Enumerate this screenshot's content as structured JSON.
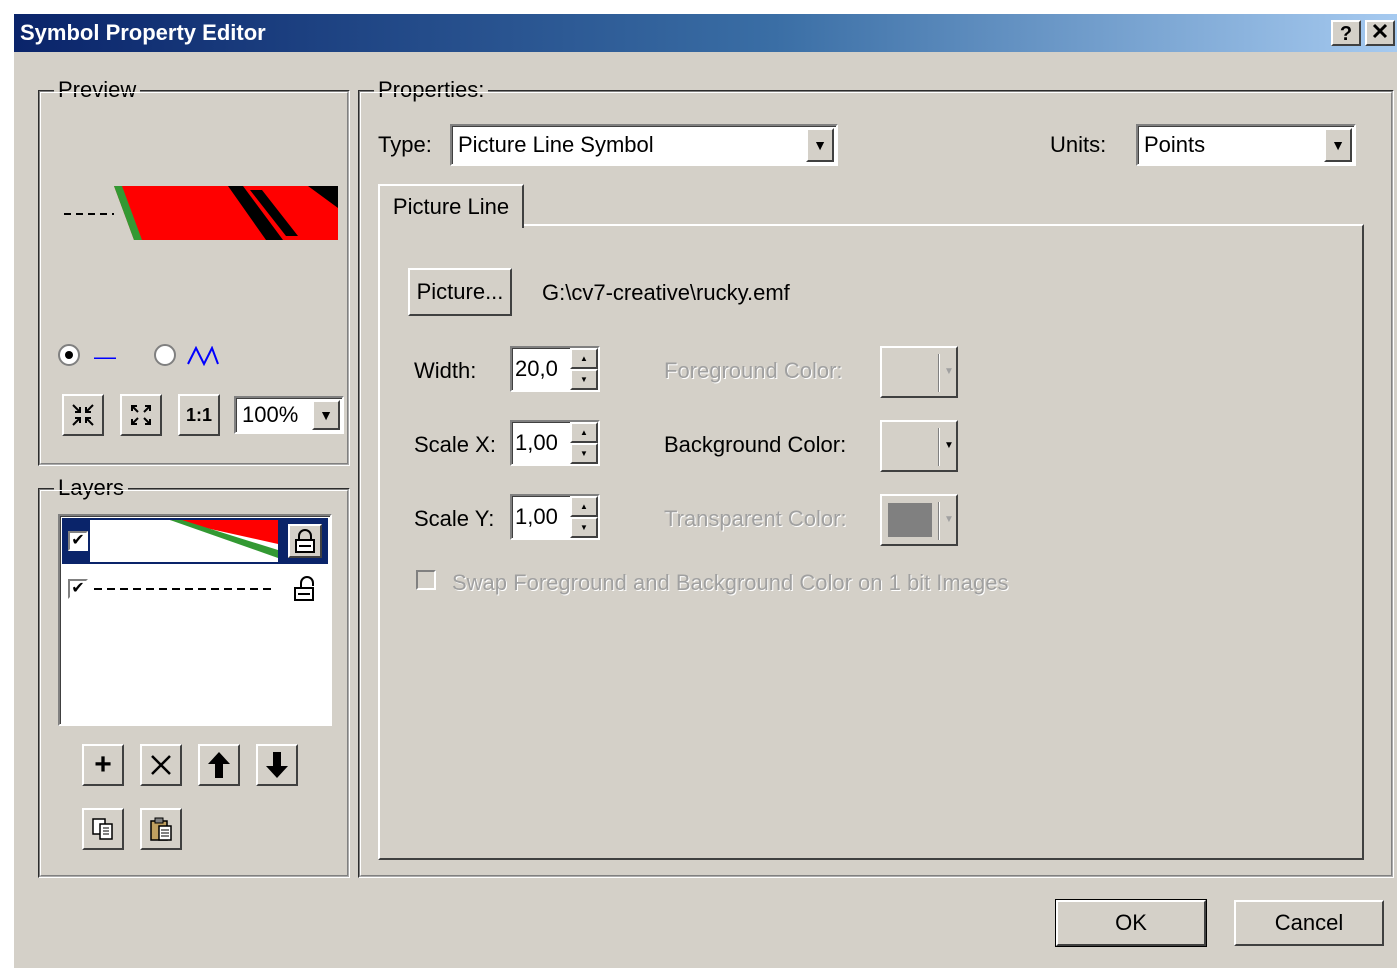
{
  "window": {
    "title": "Symbol Property Editor",
    "help_label": "?",
    "close_label": "✕"
  },
  "preview": {
    "group_label": "Preview",
    "zoom": "100%",
    "mode_line_icon": "—",
    "mode_zigzag_icon": "⋀⋀",
    "fit_icon": "shrink-arrows-icon",
    "expand_icon": "expand-arrows-icon",
    "actual_size_label": "1:1"
  },
  "layers": {
    "group_label": "Layers",
    "items": [
      {
        "checked": true,
        "locked": true
      },
      {
        "checked": true,
        "locked": false
      }
    ],
    "buttons": {
      "add": "+",
      "remove": "✕",
      "up": "⬆",
      "down": "⬇"
    }
  },
  "properties": {
    "group_label": "Properties:",
    "type_label": "Type:",
    "type_value": "Picture Line Symbol",
    "units_label": "Units:",
    "units_value": "Points",
    "tab_label": "Picture Line",
    "picture_button": "Picture...",
    "picture_path": "G:\\cv7-creative\\rucky.emf",
    "width_label": "Width:",
    "width_value": "20,0",
    "scalex_label": "Scale X:",
    "scalex_value": "1,00",
    "scaley_label": "Scale Y:",
    "scaley_value": "1,00",
    "fg_color_label": "Foreground Color:",
    "bg_color_label": "Background Color:",
    "transparent_color_label": "Transparent Color:",
    "swap_label": "Swap Foreground and Background Color on 1 bit Images",
    "transparent_swatch": "#808080"
  },
  "buttons": {
    "ok": "OK",
    "cancel": "Cancel"
  },
  "colors": {
    "red": "#ff0000",
    "green": "#339933",
    "selection": "#0a246a"
  }
}
